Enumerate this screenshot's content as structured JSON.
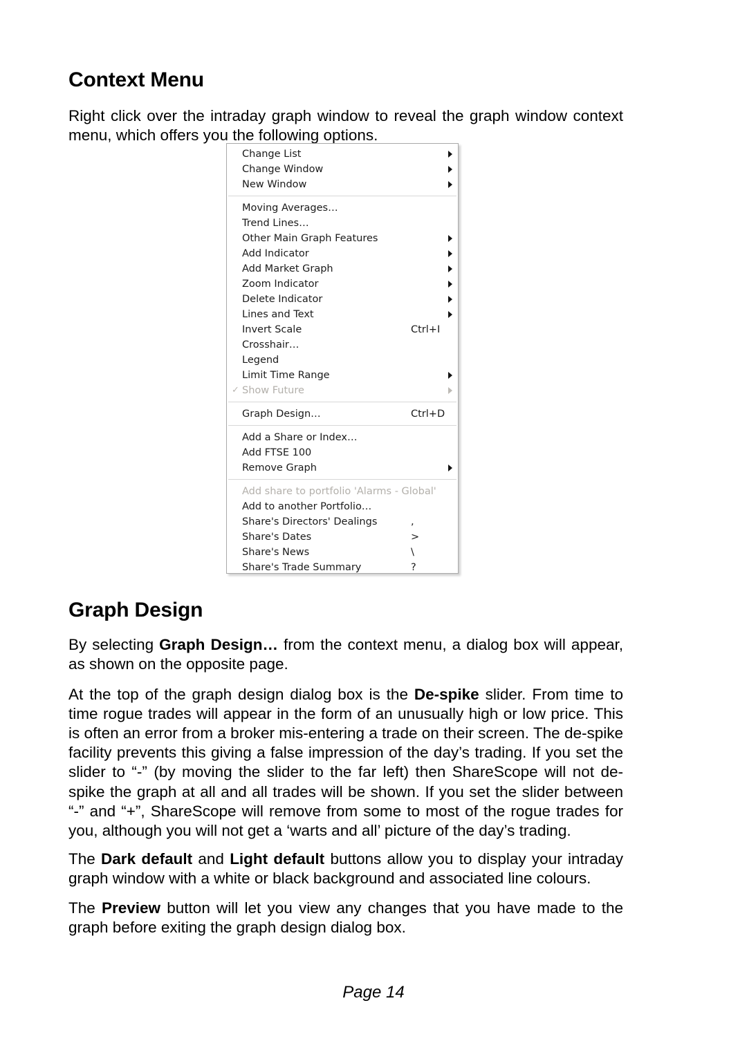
{
  "document": {
    "footer": "Page 14"
  },
  "sections": {
    "context_menu": {
      "heading": "Context Menu",
      "intro": "Right click over the intraday graph window to reveal the graph window context menu, which offers you the following options."
    },
    "graph_design": {
      "heading": "Graph Design",
      "para1_a": "By selecting ",
      "para1_b": "Graph Design…",
      "para1_c": " from the context menu, a dialog box will appear, as shown on the opposite page.",
      "para2_a": "At the top of the graph design dialog box is the ",
      "para2_b": "De-spike",
      "para2_c": " slider.  From time to time rogue trades will appear in the form of an unusually high or low price.  This is often an error from a broker mis-entering a trade on their screen.  The de-spike facility prevents this giving a false impression of the day’s trading.  If you set the slider to “-” (by moving the slider to the far left) then ShareScope will not de-spike the graph at all and all trades will be shown. If you set the slider between “-” and “+”, ShareScope will remove from some to most of the rogue trades for you, although you will not get a ‘warts and all’ picture of the day’s trading.",
      "para3_a": "The ",
      "para3_b": "Dark default",
      "para3_c": " and ",
      "para3_d": "Light default",
      "para3_e": " buttons allow you to display your intraday graph window with a white or black background and associated line colours.",
      "para4_a": "The ",
      "para4_b": "Preview",
      "para4_c": " button will let you view any changes that you have made to the graph before exiting the graph design dialog box."
    }
  },
  "context_menu_screenshot": {
    "check_glyph": "✓",
    "groups": [
      {
        "items": [
          {
            "label": "Change List",
            "accel": "",
            "submenu": true,
            "disabled": false,
            "checked": false
          },
          {
            "label": "Change Window",
            "accel": "",
            "submenu": true,
            "disabled": false,
            "checked": false
          },
          {
            "label": "New Window",
            "accel": "",
            "submenu": true,
            "disabled": false,
            "checked": false
          }
        ]
      },
      {
        "items": [
          {
            "label": "Moving Averages…",
            "accel": "",
            "submenu": false,
            "disabled": false,
            "checked": false
          },
          {
            "label": "Trend Lines…",
            "accel": "",
            "submenu": false,
            "disabled": false,
            "checked": false
          },
          {
            "label": "Other Main Graph Features",
            "accel": "",
            "submenu": true,
            "disabled": false,
            "checked": false
          },
          {
            "label": "Add Indicator",
            "accel": "",
            "submenu": true,
            "disabled": false,
            "checked": false
          },
          {
            "label": "Add Market Graph",
            "accel": "",
            "submenu": true,
            "disabled": false,
            "checked": false
          },
          {
            "label": "Zoom Indicator",
            "accel": "",
            "submenu": true,
            "disabled": false,
            "checked": false
          },
          {
            "label": "Delete Indicator",
            "accel": "",
            "submenu": true,
            "disabled": false,
            "checked": false
          },
          {
            "label": "Lines and Text",
            "accel": "",
            "submenu": true,
            "disabled": false,
            "checked": false
          },
          {
            "label": "Invert Scale",
            "accel": "Ctrl+I",
            "submenu": false,
            "disabled": false,
            "checked": false
          },
          {
            "label": "Crosshair…",
            "accel": "",
            "submenu": false,
            "disabled": false,
            "checked": false
          },
          {
            "label": "Legend",
            "accel": "",
            "submenu": false,
            "disabled": false,
            "checked": false
          },
          {
            "label": "Limit Time Range",
            "accel": "",
            "submenu": true,
            "disabled": false,
            "checked": false
          },
          {
            "label": "Show Future",
            "accel": "",
            "submenu": true,
            "disabled": true,
            "checked": true
          }
        ]
      },
      {
        "items": [
          {
            "label": "Graph Design…",
            "accel": "Ctrl+D",
            "submenu": false,
            "disabled": false,
            "checked": false
          }
        ]
      },
      {
        "items": [
          {
            "label": "Add a Share or Index…",
            "accel": "",
            "submenu": false,
            "disabled": false,
            "checked": false
          },
          {
            "label": "Add FTSE 100",
            "accel": "",
            "submenu": false,
            "disabled": false,
            "checked": false
          },
          {
            "label": "Remove Graph",
            "accel": "",
            "submenu": true,
            "disabled": false,
            "checked": false
          }
        ]
      },
      {
        "items": [
          {
            "label": "Add share to portfolio 'Alarms - Global'",
            "accel": "",
            "submenu": false,
            "disabled": true,
            "checked": false
          },
          {
            "label": "Add to another Portfolio…",
            "accel": "",
            "submenu": false,
            "disabled": false,
            "checked": false
          },
          {
            "label": "Share's Directors' Dealings",
            "accel": ",",
            "submenu": false,
            "disabled": false,
            "checked": false
          },
          {
            "label": "Share's Dates",
            "accel": ">",
            "submenu": false,
            "disabled": false,
            "checked": false
          },
          {
            "label": "Share's News",
            "accel": "\\",
            "submenu": false,
            "disabled": false,
            "checked": false
          },
          {
            "label": "Share's Trade Summary",
            "accel": "?",
            "submenu": false,
            "disabled": false,
            "checked": false
          }
        ]
      }
    ]
  }
}
